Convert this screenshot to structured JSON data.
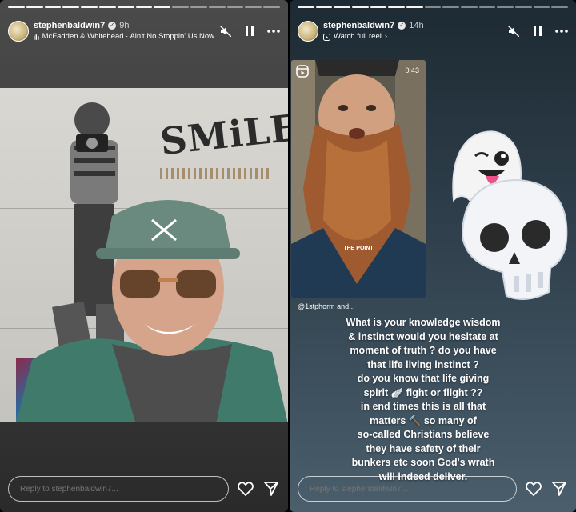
{
  "stories": [
    {
      "username": "stephenbaldwin7",
      "time": "9h",
      "audio_label": "McFadden & Whitehead · Ain't No Stoppin' Us Now",
      "photo_text": "SMiLE!",
      "reply_placeholder": "Reply to stephenbaldwin7..."
    },
    {
      "username": "stephenbaldwin7",
      "time": "14h",
      "link_label": "Watch full reel",
      "reel_timer": "0:43",
      "reel_caption": "THE POINT",
      "mention": "@1stphorm and...",
      "body": "What is your knowledge wisdom\n& instinct would you hesitate at\nmoment of truth ? do you have\nthat life living instinct ?\ndo you know that life giving\nspirit  🪽 fight or flight ??\nin end times this is all that\nmatters 🔨 so many of\nso-called Christians believe\nthey have safety of their\nbunkers etc soon God's wrath\nwill indeed deliver.",
      "reply_placeholder": "Reply to stephenbaldwin7..."
    }
  ],
  "icons": {
    "verified": "verified-badge-icon",
    "audio": "music-bars-icon",
    "mute": "mute-icon",
    "pause": "pause-icon",
    "more": "more-dots-icon",
    "like": "heart-icon",
    "share": "send-icon",
    "reel": "reel-icon"
  }
}
